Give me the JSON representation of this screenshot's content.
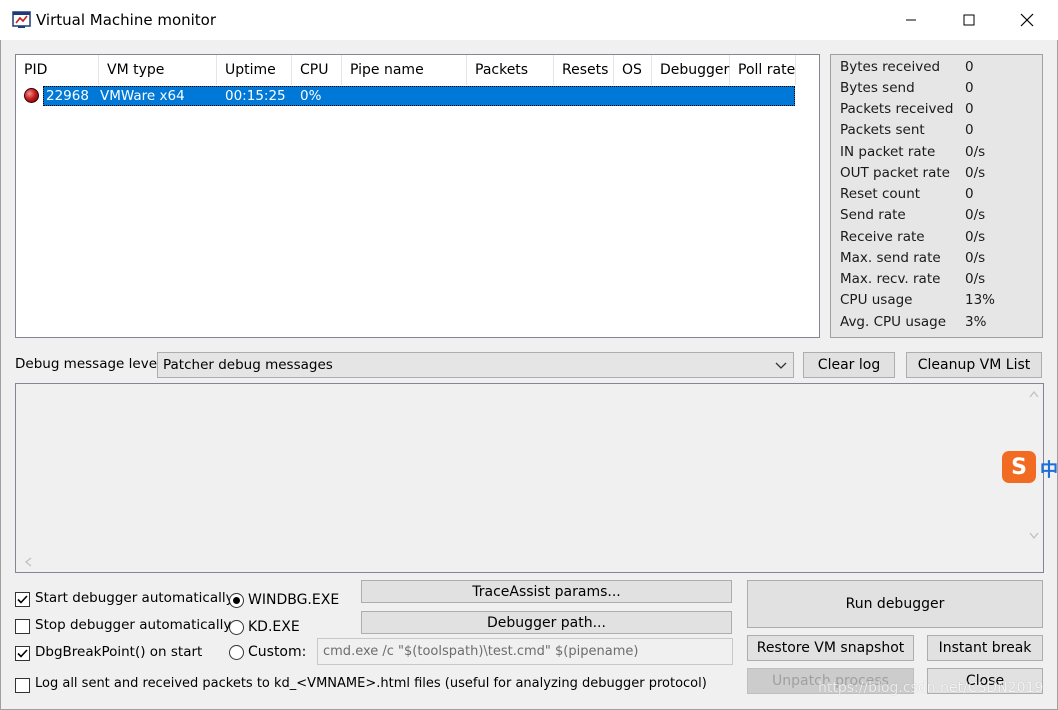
{
  "window": {
    "title": "Virtual Machine monitor"
  },
  "list": {
    "columns": [
      "PID",
      "VM type",
      "Uptime",
      "CPU",
      "Pipe name",
      "Packets",
      "Resets",
      "OS",
      "Debugger",
      "Poll rate"
    ],
    "rows": [
      {
        "pid": "22968",
        "vm_type": "VMWare x64",
        "uptime": "00:15:25",
        "cpu": "0%"
      }
    ]
  },
  "stats": [
    {
      "label": "Bytes received",
      "value": "0"
    },
    {
      "label": "Bytes send",
      "value": "0"
    },
    {
      "label": "Packets received",
      "value": "0"
    },
    {
      "label": "Packets sent",
      "value": "0"
    },
    {
      "label": "IN packet rate",
      "value": "0/s"
    },
    {
      "label": "OUT packet rate",
      "value": "0/s"
    },
    {
      "label": "Reset count",
      "value": "0"
    },
    {
      "label": "Send rate",
      "value": "0/s"
    },
    {
      "label": "Receive rate",
      "value": "0/s"
    },
    {
      "label": "Max. send rate",
      "value": "0/s"
    },
    {
      "label": "Max. recv. rate",
      "value": "0/s"
    },
    {
      "label": "CPU usage",
      "value": "13%"
    },
    {
      "label": "Avg. CPU usage",
      "value": "3%"
    }
  ],
  "debug": {
    "label": "Debug message level:",
    "selected": "Patcher debug messages",
    "clear_log": "Clear log",
    "cleanup": "Cleanup VM List"
  },
  "options": {
    "start_auto": {
      "label": "Start debugger automatically",
      "checked": true
    },
    "stop_auto": {
      "label": "Stop debugger automatically",
      "checked": false
    },
    "dbgbreak": {
      "label": "DbgBreakPoint() on start",
      "checked": true
    },
    "log_packets": {
      "label": "Log all sent and received packets to kd_<VMNAME>.html files (useful for analyzing debugger protocol)",
      "checked": false
    }
  },
  "debugger_choice": {
    "windbg": "WINDBG.EXE",
    "kd": "KD.EXE",
    "custom": "Custom:",
    "selected": "windbg",
    "custom_cmd": "cmd.exe /c \"$(toolspath)\\test.cmd\" $(pipename)"
  },
  "buttons": {
    "traceassist": "TraceAssist params...",
    "debugger_path": "Debugger path...",
    "run": "Run debugger",
    "restore": "Restore VM snapshot",
    "instant_break": "Instant break",
    "unpatch": "Unpatch process",
    "close": "Close"
  },
  "ime": {
    "logo": "S",
    "text": "中"
  },
  "watermark": "https://blog.csdn.net/CSDN2019",
  "colors": {
    "selection": "#0078d7",
    "ime": "#f26b22"
  }
}
